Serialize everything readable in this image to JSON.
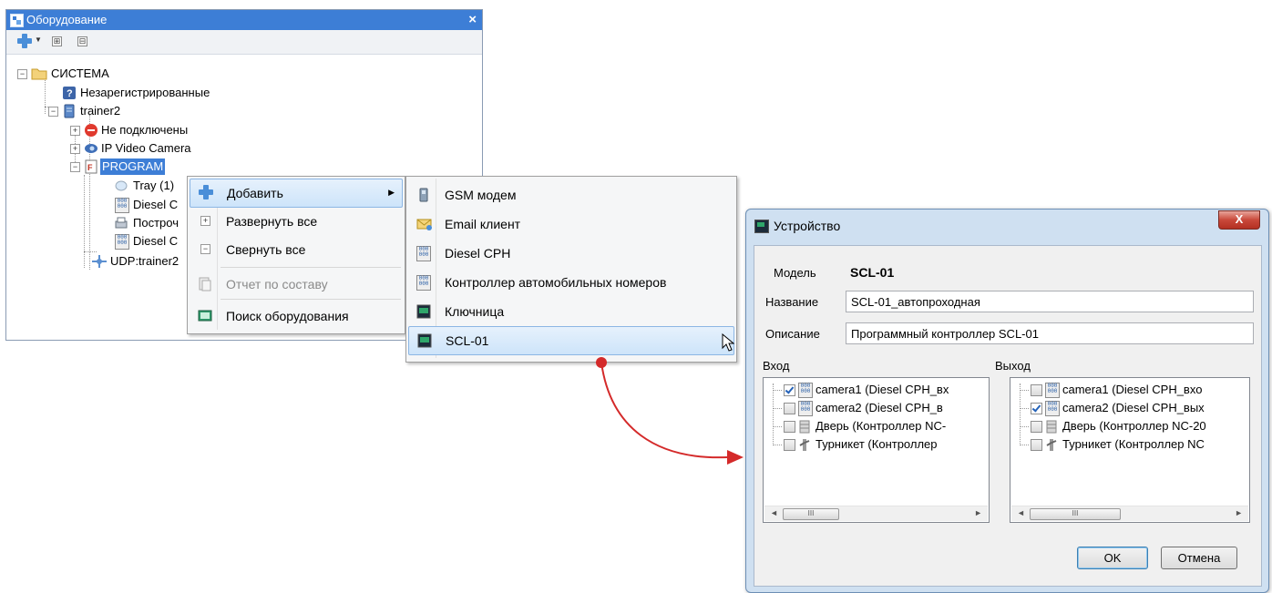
{
  "panel": {
    "title": "Оборудование",
    "close_glyph": "×",
    "toolbar": {
      "expand_glyph": "⊞",
      "collapse_glyph": "⊟"
    },
    "tree": {
      "root": "СИСТЕМА",
      "unregistered": "Незарегистрированные",
      "server": "trainer2",
      "not_connected": "Не подключены",
      "ip_camera": "IP Video Camera",
      "program": "PROGRAM",
      "tray": "Tray (1)",
      "diesel1": "Diesel C",
      "builder": "Построч",
      "diesel2": "Diesel C",
      "udp": "UDP:trainer2"
    }
  },
  "context_menu": {
    "add": "Добавить",
    "expand_all": "Развернуть все",
    "collapse_all": "Свернуть все",
    "report": "Отчет по составу",
    "search": "Поиск оборудования",
    "arrow": "▶"
  },
  "submenu": {
    "items": [
      "GSM модем",
      "Email клиент",
      "Diesel CPH",
      "Контроллер автомобильных номеров",
      "Ключница",
      "SCL-01"
    ]
  },
  "dialog": {
    "title": "Устройство",
    "close_glyph": "X",
    "model_label": "Модель",
    "model_value": "SCL-01",
    "name_label": "Название",
    "name_value": "SCL-01_автопроходная",
    "desc_label": "Описание",
    "desc_value": "Программный контроллер SCL-01",
    "input_label": "Вход",
    "output_label": "Выход",
    "input_items": [
      "camera1 (Diesel CPH_вх",
      "camera2 (Diesel CPH_в",
      "Дверь (Контроллер NC-",
      "Турникет (Контроллер"
    ],
    "input_checked": [
      true,
      false,
      false,
      false
    ],
    "output_items": [
      "camera1 (Diesel CPH_вхо",
      "camera2 (Diesel CPH_вых",
      "Дверь (Контроллер NC-20",
      "Турникет (Контроллер NC"
    ],
    "output_checked": [
      false,
      true,
      false,
      false
    ],
    "scroll_left": "◄",
    "scroll_right": "►",
    "scroll_thumb": "III",
    "ok": "OK",
    "cancel": "Отмена"
  },
  "colors": {
    "accent": "#3d7ed6",
    "arrow": "#d42a2a",
    "highlight": "#cde4fa"
  }
}
